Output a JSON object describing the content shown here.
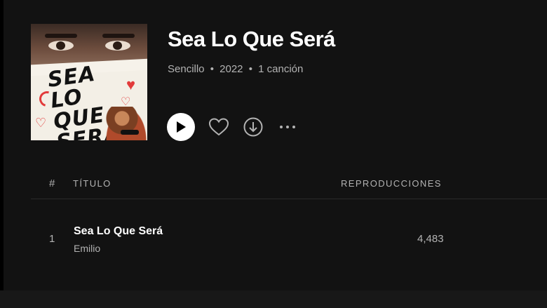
{
  "album": {
    "title": "Sea Lo Que Será",
    "type": "Sencillo",
    "year": "2022",
    "track_count": "1 canción",
    "separator": "•",
    "cover_text": [
      "SEA",
      "LO QUE",
      "SERÁ"
    ]
  },
  "controls": {
    "play_icon": "play-icon",
    "like_icon": "heart-outline-icon",
    "download_icon": "download-circle-icon",
    "more_icon": "more-horizontal-icon"
  },
  "table": {
    "header": {
      "number": "#",
      "title": "TÍTULO",
      "plays": "REPRODUCCIONES"
    },
    "rows": [
      {
        "number": "1",
        "title": "Sea Lo Que Será",
        "artist": "Emilio",
        "plays": "4,483"
      }
    ]
  },
  "colors": {
    "background": "#121212",
    "text_primary": "#ffffff",
    "text_secondary": "#b3b3b3",
    "accent_red": "#e23b3b"
  }
}
